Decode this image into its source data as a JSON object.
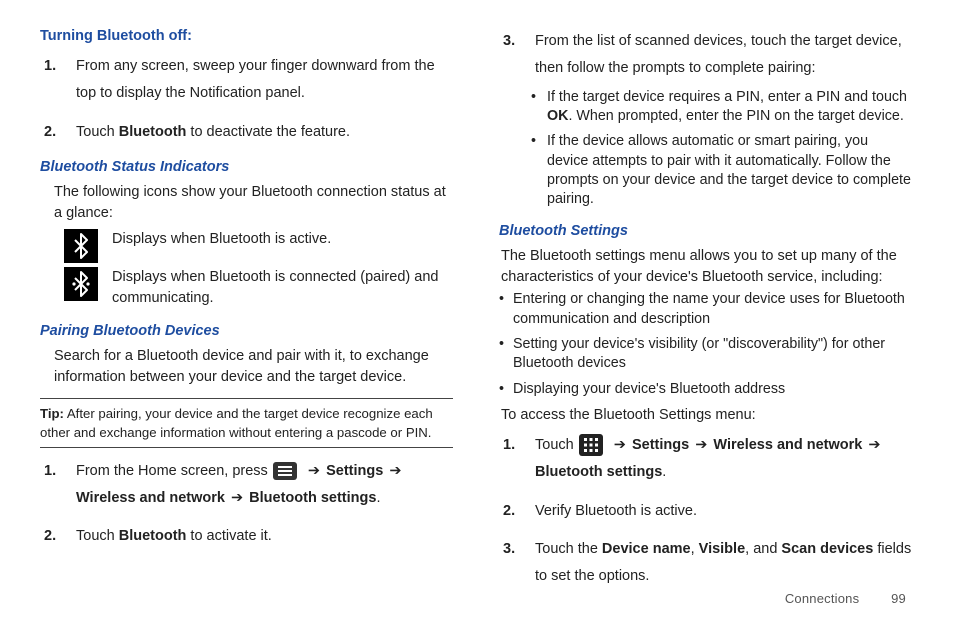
{
  "left": {
    "h_turn_off": "Turning Bluetooth off:",
    "off_steps": {
      "s1": "From any screen, sweep your finger downward from the top to display the Notification panel.",
      "s2a": "Touch ",
      "s2b": "Bluetooth",
      "s2c": " to deactivate the feature."
    },
    "h_status": "Bluetooth Status Indicators",
    "status_intro": "The following icons show your Bluetooth connection status at a glance:",
    "icon1_text": "Displays when Bluetooth is active.",
    "icon2_text": "Displays when Bluetooth is connected (paired) and communicating.",
    "h_pairing": "Pairing Bluetooth Devices",
    "pair_intro": "Search for a Bluetooth device and pair with it, to exchange information between your device and the target device.",
    "tip_label": "Tip:",
    "tip_text": " After pairing, your device and the target device recognize each other and exchange information without entering a pascode or PIN.",
    "pair_steps": {
      "s1a": "From the Home screen, press ",
      "s1b": " Settings ",
      "s1c": "Wireless and network",
      "s1d": " Bluetooth settings",
      "arrow": "➔",
      "s2a": "Touch ",
      "s2b": "Bluetooth",
      "s2c": " to activate it."
    }
  },
  "right": {
    "list3": {
      "intro": "From the list of scanned devices, touch the target device, then follow the prompts to complete pairing:",
      "b1a": "If the target device requires a PIN, enter a PIN and touch ",
      "b1b": "OK",
      "b1c": ". When prompted, enter the PIN on the target device.",
      "b2": "If the device allows automatic or smart pairing, you device attempts to pair with it automatically. Follow the prompts on your device and the target device to complete pairing."
    },
    "h_settings": "Bluetooth Settings",
    "settings_intro": "The Bluetooth settings menu allows you to set up many of the characteristics of your device's Bluetooth service, including:",
    "settings_bullets": {
      "b1": "Entering or changing the name your device uses for Bluetooth communication and description",
      "b2": "Setting your device's visibility (or \"discoverability\") for other Bluetooth devices",
      "b3": "Displaying your device's Bluetooth address"
    },
    "access_intro": "To access the Bluetooth Settings menu:",
    "access_steps": {
      "s1a": "Touch ",
      "s1b": " Settings ",
      "s1c": " Wireless and network ",
      "s1d": "Bluetooth settings",
      "arrow": "➔",
      "s2": "Verify Bluetooth is active.",
      "s3a": "Touch the ",
      "s3b": "Device name",
      "s3c": ", ",
      "s3d": "Visible",
      "s3e": ", and ",
      "s3f": "Scan devices",
      "s3g": " fields to set the options."
    }
  },
  "footer": {
    "section": "Connections",
    "page": "99"
  }
}
